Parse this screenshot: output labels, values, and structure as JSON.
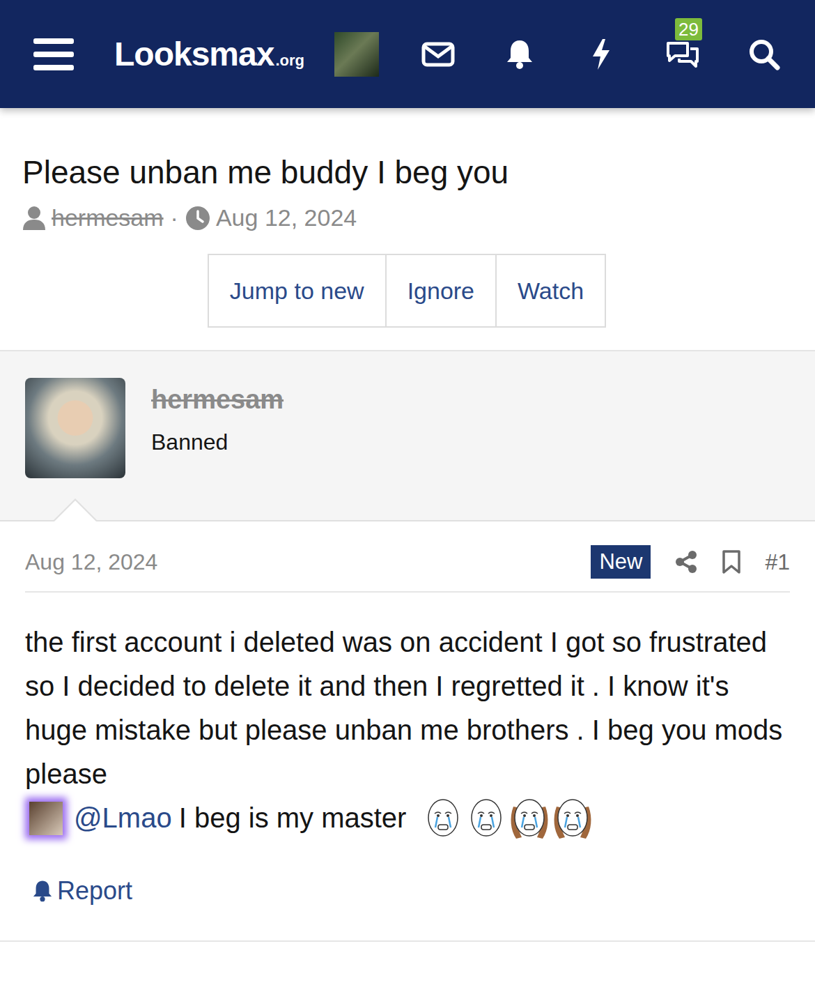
{
  "header": {
    "logo": "Looksmax",
    "logo_suffix": ".org",
    "notification_badge": "29"
  },
  "thread": {
    "title": "Please unban me buddy I beg you",
    "author": "hermesam",
    "author_banned": true,
    "date": "Aug 12, 2024"
  },
  "thread_buttons": [
    "Jump to new",
    "Ignore",
    "Watch"
  ],
  "post": {
    "username": "hermesam",
    "banned": true,
    "user_title": "Banned",
    "date": "Aug 12, 2024",
    "badge": "New",
    "number": "#1",
    "body": "the first account i deleted was on accident I got so frustrated so I decided to delete it and then I regretted it . I know it's huge mistake but please unban me brothers . I beg you mods please",
    "mention": "@Lmao",
    "after_mention": "I beg is my master",
    "emojis": [
      {
        "kind": "plain"
      },
      {
        "kind": "plain"
      },
      {
        "kind": "braids"
      },
      {
        "kind": "braids"
      }
    ],
    "report": "Report"
  }
}
